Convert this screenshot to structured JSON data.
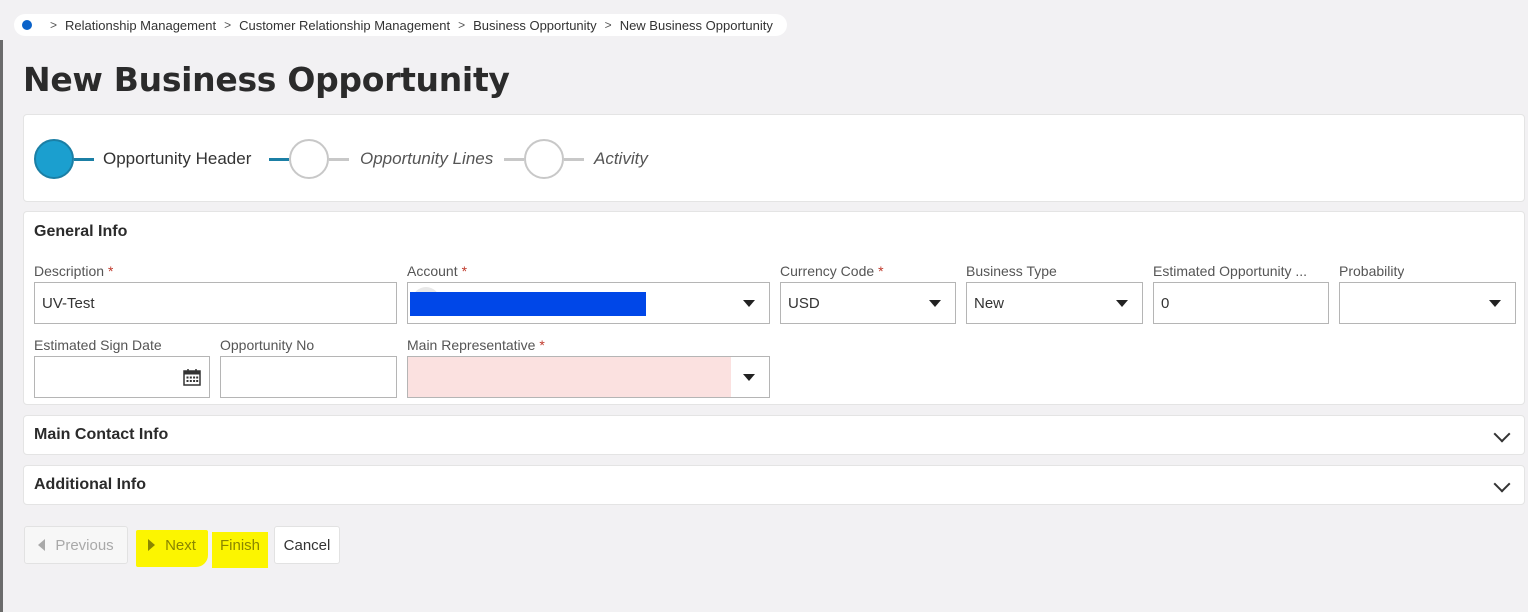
{
  "breadcrumb": {
    "items": [
      "Relationship Management",
      "Customer Relationship Management",
      "Business Opportunity",
      "New Business Opportunity"
    ]
  },
  "page_title": "New Business Opportunity",
  "stepper": {
    "steps": [
      {
        "label": "Opportunity Header",
        "active": true
      },
      {
        "label": "Opportunity Lines",
        "active": false
      },
      {
        "label": "Activity",
        "active": false
      }
    ]
  },
  "general_info": {
    "title": "General Info",
    "description": {
      "label": "Description",
      "value": "UV-Test"
    },
    "account": {
      "label": "Account",
      "value": ""
    },
    "currency_code": {
      "label": "Currency Code",
      "value": "USD"
    },
    "business_type": {
      "label": "Business Type",
      "value": "New"
    },
    "estimated_opportunity": {
      "label": "Estimated Opportunity ...",
      "value": "0"
    },
    "probability": {
      "label": "Probability",
      "value": ""
    },
    "estimated_sign_date": {
      "label": "Estimated Sign Date",
      "value": ""
    },
    "opportunity_no": {
      "label": "Opportunity No",
      "value": ""
    },
    "main_representative": {
      "label": "Main Representative",
      "value": ""
    },
    "required_mark": "*"
  },
  "main_contact_info": {
    "title": "Main Contact Info"
  },
  "additional_info": {
    "title": "Additional Info"
  },
  "buttons": {
    "previous": "Previous",
    "next": "Next",
    "finish": "Finish",
    "cancel": "Cancel"
  },
  "colors": {
    "accent": "#1b9fcf",
    "error_fill": "#fbe1e0",
    "highlight": "#fcf500",
    "redaction": "#0047e8"
  }
}
